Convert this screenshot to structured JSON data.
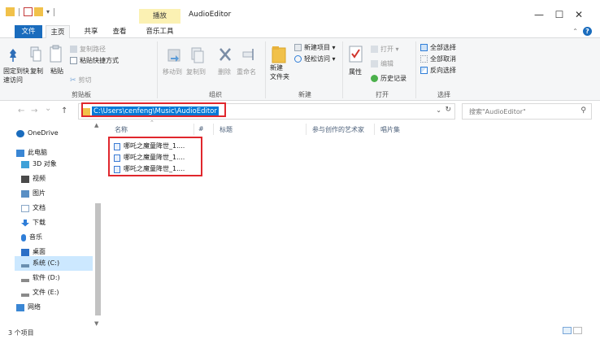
{
  "window": {
    "title": "AudioEditor",
    "context_tab": "播放",
    "minimize": "—",
    "maximize": "☐",
    "close": "✕"
  },
  "tabs": {
    "file": "文件",
    "home": "主页",
    "share": "共享",
    "view": "查看",
    "music_tools": "音乐工具"
  },
  "ribbon": {
    "clipboard": {
      "pin_quick": "固定到快\n速访问",
      "copy": "复制",
      "paste": "粘贴",
      "copy_path": "复制路径",
      "paste_shortcut": "粘贴快捷方式",
      "cut": "剪切",
      "label": "剪贴板"
    },
    "organize": {
      "move_to": "移动到",
      "copy_to": "复制到",
      "delete": "删除",
      "rename": "重命名",
      "label": "组织"
    },
    "new": {
      "new_folder": "新建\n文件夹",
      "new_item": "新建项目 ▾",
      "easy_access": "轻松访问 ▾",
      "label": "新建"
    },
    "open": {
      "properties": "属性",
      "open": "打开 ▾",
      "edit": "编辑",
      "history": "历史记录",
      "label": "打开"
    },
    "select": {
      "select_all": "全部选择",
      "select_none": "全部取消",
      "invert": "反向选择",
      "label": "选择"
    }
  },
  "address": {
    "path": "C:\\Users\\cenfeng\\Music\\AudioEditor",
    "search_placeholder": "搜索\"AudioEditor\""
  },
  "nav": {
    "back": "←",
    "forward": "→",
    "recent": "⌄",
    "up": "↑",
    "items": [
      {
        "label": "OneDrive",
        "color": "#1a6cbd"
      },
      {
        "label": "此电脑",
        "color": "#3a86d4"
      },
      {
        "label": "3D 对象",
        "color": "#3fa1d8"
      },
      {
        "label": "视频",
        "color": "#4a4a4a"
      },
      {
        "label": "图片",
        "color": "#5a8fc4"
      },
      {
        "label": "文档",
        "color": "#8aa8c8"
      },
      {
        "label": "下载",
        "color": "#2f7ed8"
      },
      {
        "label": "音乐",
        "color": "#2f7ed8"
      },
      {
        "label": "桌面",
        "color": "#2b6fc7"
      },
      {
        "label": "系统 (C:)",
        "color": "#6a8fb0"
      },
      {
        "label": "软件 (D:)",
        "color": "#8a8a8a"
      },
      {
        "label": "文件 (E:)",
        "color": "#8a8a8a"
      },
      {
        "label": "网络",
        "color": "#3a86d4"
      }
    ]
  },
  "columns": {
    "name": "名称",
    "number": "#",
    "title": "标题",
    "artist": "参与创作的艺术家",
    "album": "唱片集"
  },
  "files": [
    {
      "name": "哪吒之魔童降世_1...."
    },
    {
      "name": "哪吒之魔童降世_1...."
    },
    {
      "name": "哪吒之魔童降世_1...."
    }
  ],
  "status": {
    "count": "3 个项目"
  }
}
